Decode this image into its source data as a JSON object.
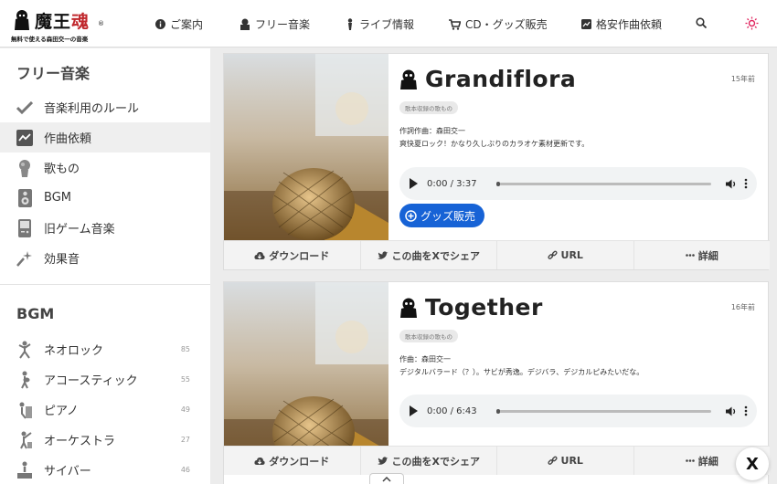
{
  "logo": {
    "text_main": "魔王",
    "text_red": "魂",
    "registered": "®",
    "subtitle": "無料で使える森田交一の音楽"
  },
  "nav": {
    "items": [
      {
        "label": "ご案内",
        "icon": "info-icon"
      },
      {
        "label": "フリー音楽",
        "icon": "figure-icon"
      },
      {
        "label": "ライブ情報",
        "icon": "singer-icon"
      },
      {
        "label": "CD・グッズ販売",
        "icon": "cart-icon"
      },
      {
        "label": "格安作曲依頼",
        "icon": "chart-icon"
      }
    ],
    "search_icon": "search-icon",
    "theme_icon": "sun-icon",
    "theme_color": "#e0245e"
  },
  "sidebar": {
    "section1_title": "フリー音楽",
    "section1_items": [
      {
        "label": "音楽利用のルール",
        "icon": "check-icon"
      },
      {
        "label": "作曲依頼",
        "icon": "chart-line-icon"
      },
      {
        "label": "歌もの",
        "icon": "singer-icon"
      },
      {
        "label": "BGM",
        "icon": "speaker-icon"
      },
      {
        "label": "旧ゲーム音楽",
        "icon": "gameboy-icon"
      },
      {
        "label": "効果音",
        "icon": "sparkle-icon"
      }
    ],
    "section2_title": "BGM",
    "section2_items": [
      {
        "label": "ネオロック",
        "count": "85",
        "icon": "dancer-icon"
      },
      {
        "label": "アコースティック",
        "count": "55",
        "icon": "guitarist-icon"
      },
      {
        "label": "ピアノ",
        "count": "49",
        "icon": "pianist-icon"
      },
      {
        "label": "オーケストラ",
        "count": "27",
        "icon": "conductor-icon"
      },
      {
        "label": "サイバー",
        "count": "46",
        "icon": "dj-icon"
      }
    ]
  },
  "cards": [
    {
      "title": "Grandiflora",
      "age": "15年前",
      "tag": "歌本収録の歌もの",
      "desc_line1": "作詞作曲：森田交一",
      "desc_line2": "爽快夏ロック！かなり久しぶりのカラオケ素材更新です。",
      "time": "0:00 / 3:37",
      "goods_label": "グッズ販売",
      "actions": {
        "download": "ダウンロード",
        "share": "この曲をXでシェア",
        "url": "URL",
        "detail": "詳細"
      }
    },
    {
      "title": "Together",
      "age": "16年前",
      "tag": "歌本収録の歌もの",
      "desc_line1": "作曲：森田交一",
      "desc_line2": "デジタルバラード（？）。サビが秀逸。デジバラ、デジカルピみたいだな。",
      "time": "0:00 / 6:43",
      "actions": {
        "download": "ダウンロード",
        "share": "この曲をXでシェア",
        "url": "URL",
        "detail": "詳細"
      }
    }
  ],
  "floating": {
    "x_label": "X"
  },
  "colors": {
    "accent_blue": "#1763d6",
    "logo_red": "#c0282d"
  }
}
